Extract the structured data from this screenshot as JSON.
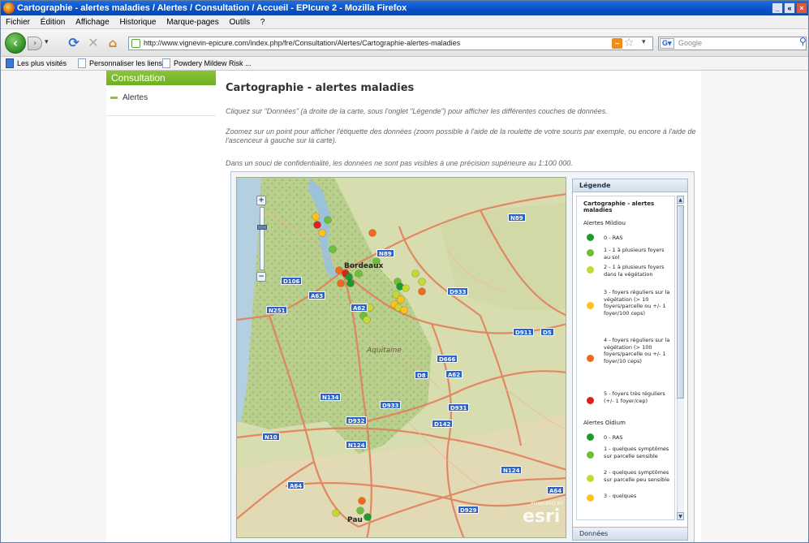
{
  "window": {
    "title": "Cartographie - alertes maladies / Alertes / Consultation / Accueil - EPIcure 2 - Mozilla Firefox",
    "controls": [
      "_",
      "«",
      "×"
    ]
  },
  "menu": [
    "Fichier",
    "Édition",
    "Affichage",
    "Historique",
    "Marque-pages",
    "Outils",
    "?"
  ],
  "nav": {
    "url": "http://www.vignevin-epicure.com/index.php/fre/Consultation/Alertes/Cartographie-alertes-maladies",
    "search_placeholder": "Google",
    "engine": "G"
  },
  "bookmarks": [
    "Les plus visités",
    "Personnaliser les liens",
    "Powdery Mildew Risk ..."
  ],
  "sidebar": {
    "header": "Consultation",
    "items": [
      {
        "label": "Alertes"
      }
    ]
  },
  "main": {
    "title": "Cartographie - alertes maladies",
    "paragraphs": [
      "Cliquez sur \"Données\" (à droite de la carte, sous l'onglet \"Légende\") pour afficher les différentes couches de données.",
      "Zoomez sur un point pour afficher l'étiquette des données (zoom possible à l'aide de la roulette de votre souris par exemple, ou encore à l'aide de l'ascenceur à gauche sur la carte).",
      "Dans un souci de confidentialité, les données ne sont pas visibles à une précision supérieure au 1:100 000."
    ]
  },
  "map": {
    "zoom_plus": "+",
    "zoom_minus": "−",
    "cities": [
      "Bordeaux",
      "Pau"
    ],
    "region": "Aquitaine",
    "roads": [
      "N89",
      "N89",
      "D106",
      "A63",
      "N251",
      "A62",
      "D933",
      "D911",
      "D5",
      "D666",
      "D8",
      "A62",
      "N134",
      "D933",
      "D931",
      "D932",
      "D142",
      "N10",
      "N124",
      "N124",
      "A64",
      "A64",
      "D929"
    ],
    "attribution_small": "POWERED BY",
    "attribution": "esri",
    "colors": {
      "ras": "#1f9a2e",
      "level1": "#6cbf3a",
      "level2": "#c6d832",
      "level3": "#ffc21a",
      "level4": "#f06a1e",
      "level5": "#e02020"
    }
  },
  "legend": {
    "header": "Légende",
    "title": "Cartographie - alertes maladies",
    "sections": [
      {
        "name": "Alertes Mildiou",
        "items": [
          {
            "label": "0 - RAS",
            "color": "#1f9a2e"
          },
          {
            "label": "1 - 1 à plusieurs foyers au sol",
            "color": "#6cbf3a"
          },
          {
            "label": "2 - 1 à plusieurs foyers dans la végétation",
            "color": "#c6d832"
          },
          {
            "label": "3 - foyers réguliers sur la végétation (> 10 foyers/parcelle ou +/- 1 foyer/100 ceps)",
            "color": "#ffc21a"
          },
          {
            "label": "4 - foyers réguliers sur la végétation (> 100 foyers/parcelle ou +/- 1 foyer/10 ceps)",
            "color": "#f06a1e"
          },
          {
            "label": "5 - foyers très réguliers (+/- 1 foyer/cep)",
            "color": "#e02020"
          }
        ]
      },
      {
        "name": "Alertes Oidium",
        "items": [
          {
            "label": "0 - RAS",
            "color": "#1f9a2e"
          },
          {
            "label": "1 - quelques symptômes sur parcelle sensible",
            "color": "#6cbf3a"
          },
          {
            "label": "2 - quelques symptômes sur parcelle peu sensible",
            "color": "#c6d832"
          },
          {
            "label": "3 - quelques",
            "color": "#ffc21a"
          }
        ]
      }
    ],
    "scroll_up": "▲",
    "scroll_down": "▼",
    "donnees_tab": "Données"
  }
}
